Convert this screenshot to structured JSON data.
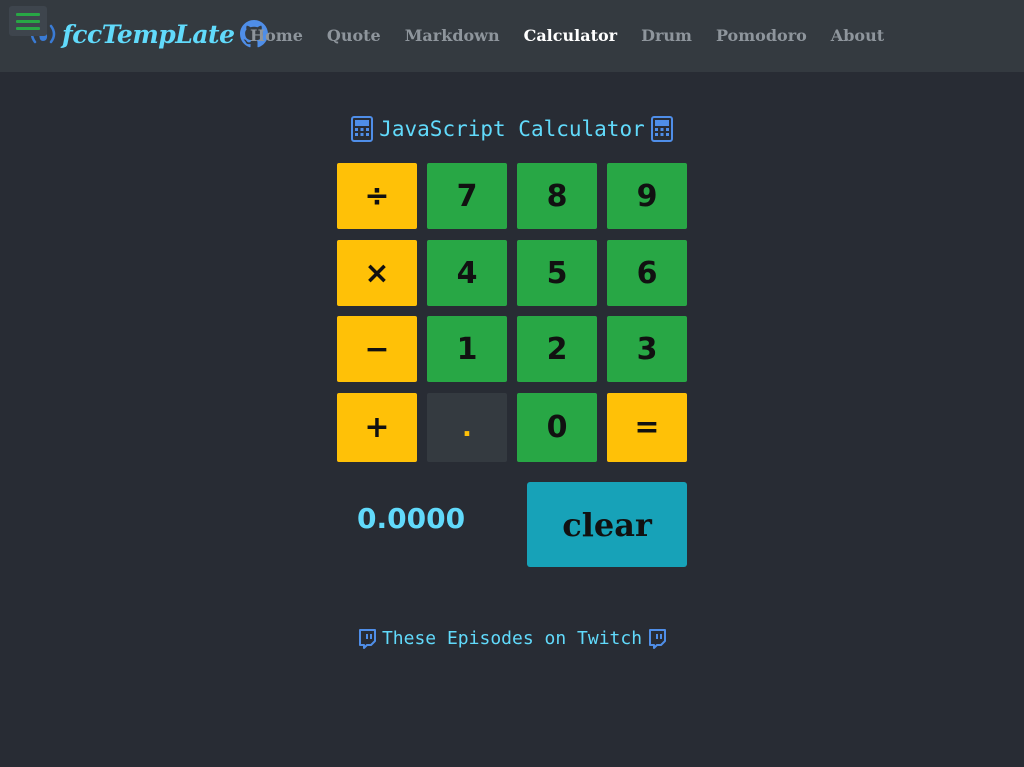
{
  "header": {
    "brand": "fccTempLate",
    "icons": {
      "menu": "hamburger-menu-icon",
      "logo": "freecodecamp-icon",
      "github": "github-icon"
    },
    "nav": [
      "Home",
      "Quote",
      "Markdown",
      "Calculator",
      "Drum",
      "Pomodoro",
      "About"
    ],
    "active": "Calculator"
  },
  "calculator": {
    "title": "JavaScript Calculator",
    "title_icon": "calculator-icon",
    "keys": {
      "divide": "÷",
      "multiply": "×",
      "subtract": "−",
      "add": "+",
      "seven": "7",
      "eight": "8",
      "nine": "9",
      "four": "4",
      "five": "5",
      "six": "6",
      "one": "1",
      "two": "2",
      "three": "3",
      "decimal": ".",
      "zero": "0",
      "equals": "=",
      "clear": "clear"
    },
    "display": "0.0000"
  },
  "footer": {
    "link": "These Episodes on Twitch",
    "icon": "twitch-icon"
  },
  "colors": {
    "background": "#282c34",
    "navbar": "#343a40",
    "accent": "#61dafb",
    "operator": "#ffc107",
    "number": "#28a745",
    "clear": "#17a2b8"
  }
}
